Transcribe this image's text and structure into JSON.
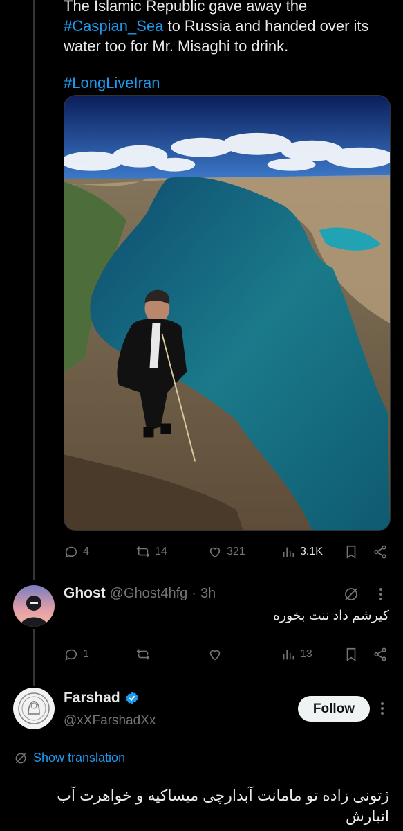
{
  "tweet": {
    "line1": "The Islamic Republic gave away the",
    "hashtag1": "#Caspian_Sea",
    "line2_rest": " to Russia and handed over its",
    "line3": "water too for Mr. Misaghi to drink.",
    "hashtag2": "#LongLiveIran"
  },
  "tweet_stats": {
    "replies": "4",
    "reposts": "14",
    "likes": "321",
    "views": "3.1K"
  },
  "reply1": {
    "name": "Ghost",
    "handle": "@Ghost4hfg",
    "separator": "·",
    "time": "3h",
    "text": "کیرشم داد ننت بخوره",
    "replies": "1",
    "views": "13"
  },
  "reply2": {
    "name": "Farshad",
    "handle": "@xXFarshadXx",
    "follow_label": "Follow",
    "show_translation": "Show translation",
    "text": "ژتونی زاده تو مامانت آبدارچی میساکیه و خواهرت آب انبارش"
  },
  "colors": {
    "background": "#000000",
    "link": "#1d9bf0",
    "muted": "#71767b",
    "verified": "#1d9bf0"
  }
}
